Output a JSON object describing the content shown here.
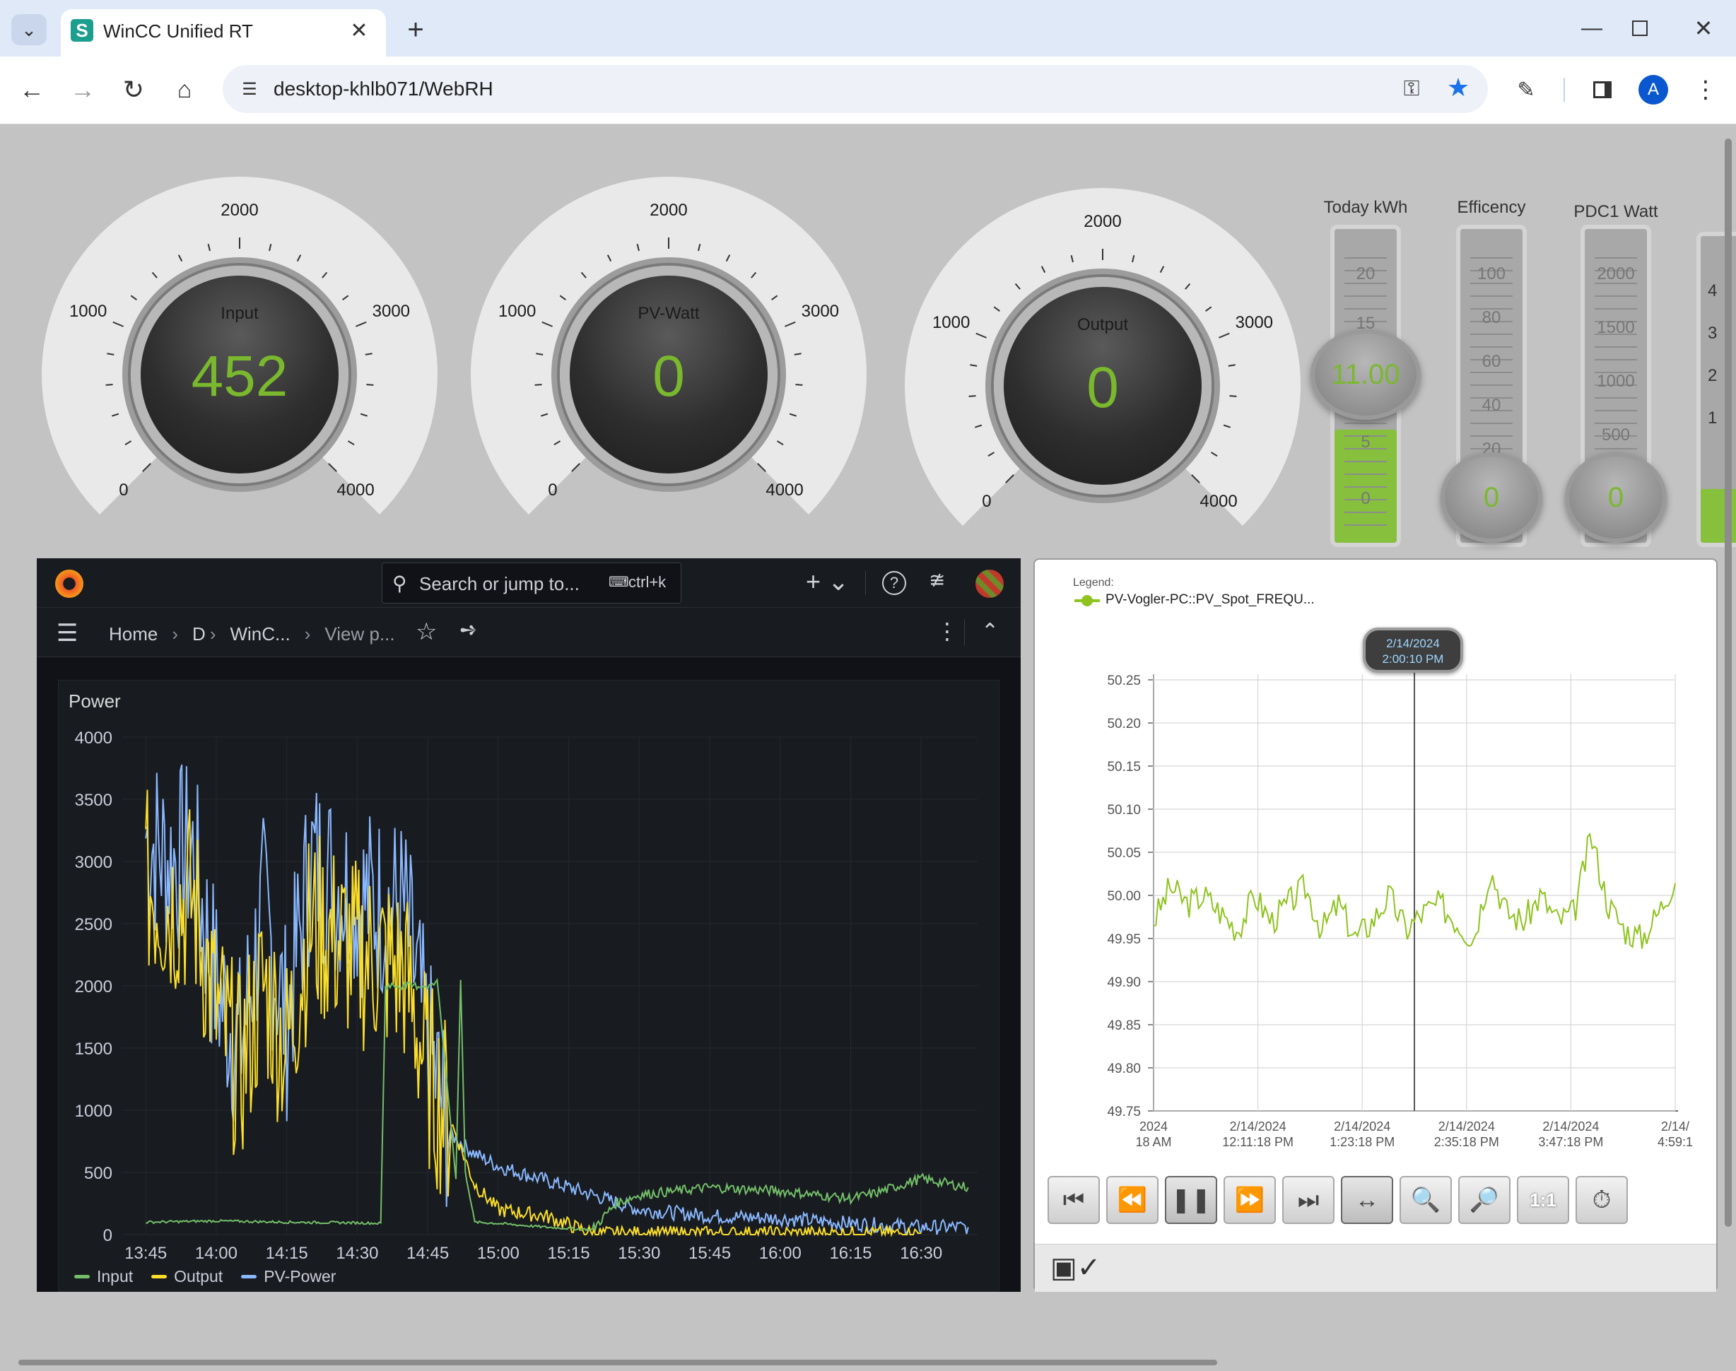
{
  "browser": {
    "tab_title": "WinCC Unified RT",
    "tab_favicon": "S",
    "url": "desktop-khlb071/WebRH",
    "profile_initial": "A"
  },
  "gauges": [
    {
      "label": "Input",
      "value": "452",
      "ticks": [
        "0",
        "1000",
        "2000",
        "3000",
        "4000"
      ]
    },
    {
      "label": "PV-Watt",
      "value": "0",
      "ticks": [
        "0",
        "1000",
        "2000",
        "3000",
        "4000"
      ]
    },
    {
      "label": "Output",
      "value": "0",
      "ticks": [
        "0",
        "1000",
        "2000",
        "3000",
        "4000"
      ]
    }
  ],
  "bars": [
    {
      "title": "Today kWh",
      "value": "11.00",
      "scale": [
        "20",
        "15",
        "5",
        "0"
      ]
    },
    {
      "title": "Efficency",
      "value": "0",
      "scale": [
        "100",
        "80",
        "60",
        "40",
        "20"
      ]
    },
    {
      "title": "PDC1 Watt",
      "value": "0",
      "scale": [
        "2000",
        "1500",
        "1000",
        "500"
      ]
    }
  ],
  "bar4_scale": [
    "4",
    "3",
    "2",
    "1"
  ],
  "grafana": {
    "search_placeholder": "Search or jump to...",
    "shortcut": "ctrl+k",
    "breadcrumb": [
      "Home",
      "D",
      "WinC...",
      "View p..."
    ],
    "panel_title": "Power",
    "legend": [
      {
        "name": "Input",
        "color": "#73bf69"
      },
      {
        "name": "Output",
        "color": "#fade2a"
      },
      {
        "name": "PV-Power",
        "color": "#8ab8ff"
      }
    ]
  },
  "trend": {
    "legend_title": "Legend:",
    "legend_item": "PV-Vogler-PC::PV_Spot_FREQU...",
    "cursor_date": "2/14/2024",
    "cursor_time": "2:00:10 PM"
  },
  "chart_data": [
    {
      "type": "line",
      "title": "Power",
      "xlabel": "",
      "ylabel": "",
      "x_ticks": [
        "13:45",
        "14:00",
        "14:15",
        "14:30",
        "14:45",
        "15:00",
        "15:15",
        "15:30",
        "15:45",
        "16:00",
        "16:15",
        "16:30"
      ],
      "y_ticks": [
        "0",
        "500",
        "1000",
        "1500",
        "2000",
        "2500",
        "3000",
        "3500",
        "4000"
      ],
      "ylim": [
        0,
        4000
      ],
      "grid": true,
      "legend_position": "bottom-left",
      "series": [
        {
          "name": "Input",
          "color": "#73bf69",
          "x": [
            "13:45",
            "14:00",
            "14:15",
            "14:30",
            "14:35",
            "14:36",
            "14:46",
            "14:47",
            "14:51",
            "14:52",
            "14:53",
            "14:55",
            "15:00",
            "15:10",
            "15:20",
            "15:25",
            "15:30",
            "15:45",
            "16:00",
            "16:15",
            "16:20",
            "16:30",
            "16:40"
          ],
          "values": [
            100,
            110,
            100,
            95,
            90,
            2000,
            2000,
            2050,
            450,
            2050,
            500,
            100,
            90,
            60,
            40,
            250,
            320,
            380,
            350,
            290,
            330,
            450,
            380
          ]
        },
        {
          "name": "Output",
          "color": "#fade2a",
          "x": [
            "13:45",
            "13:50",
            "13:55",
            "14:00",
            "14:05",
            "14:10",
            "14:15",
            "14:20",
            "14:30",
            "14:35",
            "14:40",
            "14:45",
            "14:50",
            "14:55",
            "15:00",
            "15:10",
            "15:20",
            "16:30"
          ],
          "values": [
            2800,
            2650,
            2700,
            1800,
            1300,
            2000,
            1500,
            2500,
            2250,
            2200,
            2100,
            1300,
            900,
            400,
            200,
            150,
            10,
            10
          ]
        },
        {
          "name": "PV-Power",
          "color": "#8ab8ff",
          "x": [
            "13:45",
            "13:50",
            "13:55",
            "14:00",
            "14:05",
            "14:10",
            "14:15",
            "14:20",
            "14:30",
            "14:40",
            "14:45",
            "14:50",
            "14:55",
            "15:00",
            "15:15",
            "15:30",
            "15:45",
            "16:00",
            "16:15",
            "16:30",
            "16:40"
          ],
          "values": [
            3200,
            3000,
            3050,
            2000,
            1500,
            2600,
            1700,
            3000,
            2700,
            2600,
            1500,
            800,
            650,
            550,
            380,
            200,
            150,
            130,
            90,
            60,
            60
          ]
        }
      ]
    },
    {
      "type": "line",
      "title": "",
      "xlabel": "",
      "ylabel": "",
      "x_ticks": [
        "2024\n18 AM",
        "2/14/2024\n12:11:18 PM",
        "2/14/2024\n1:23:18 PM",
        "2/14/2024\n2:35:18 PM",
        "2/14/2024\n3:47:18 PM",
        "2/14/\n4:59:1"
      ],
      "y_ticks": [
        "50.25",
        "50.20",
        "50.15",
        "50.10",
        "50.05",
        "50.00",
        "49.95",
        "49.90",
        "49.85",
        "49.80",
        "49.75"
      ],
      "ylim": [
        49.75,
        50.25
      ],
      "grid": true,
      "series": [
        {
          "name": "PV-Vogler-PC::PV_Spot_FREQU...",
          "color": "#8fc31f",
          "values": [
            49.97,
            50.01,
            49.99,
            50.0,
            49.98,
            49.96,
            50.0,
            49.97,
            49.99,
            50.01,
            49.96,
            49.99,
            49.95,
            49.97,
            50.0,
            49.96,
            49.98,
            49.99,
            49.97,
            49.95,
            50.03,
            49.98,
            49.97,
            50.0,
            49.97,
            49.98,
            50.07,
            49.99,
            49.96,
            49.95,
            49.98,
            50.02
          ]
        }
      ]
    }
  ]
}
